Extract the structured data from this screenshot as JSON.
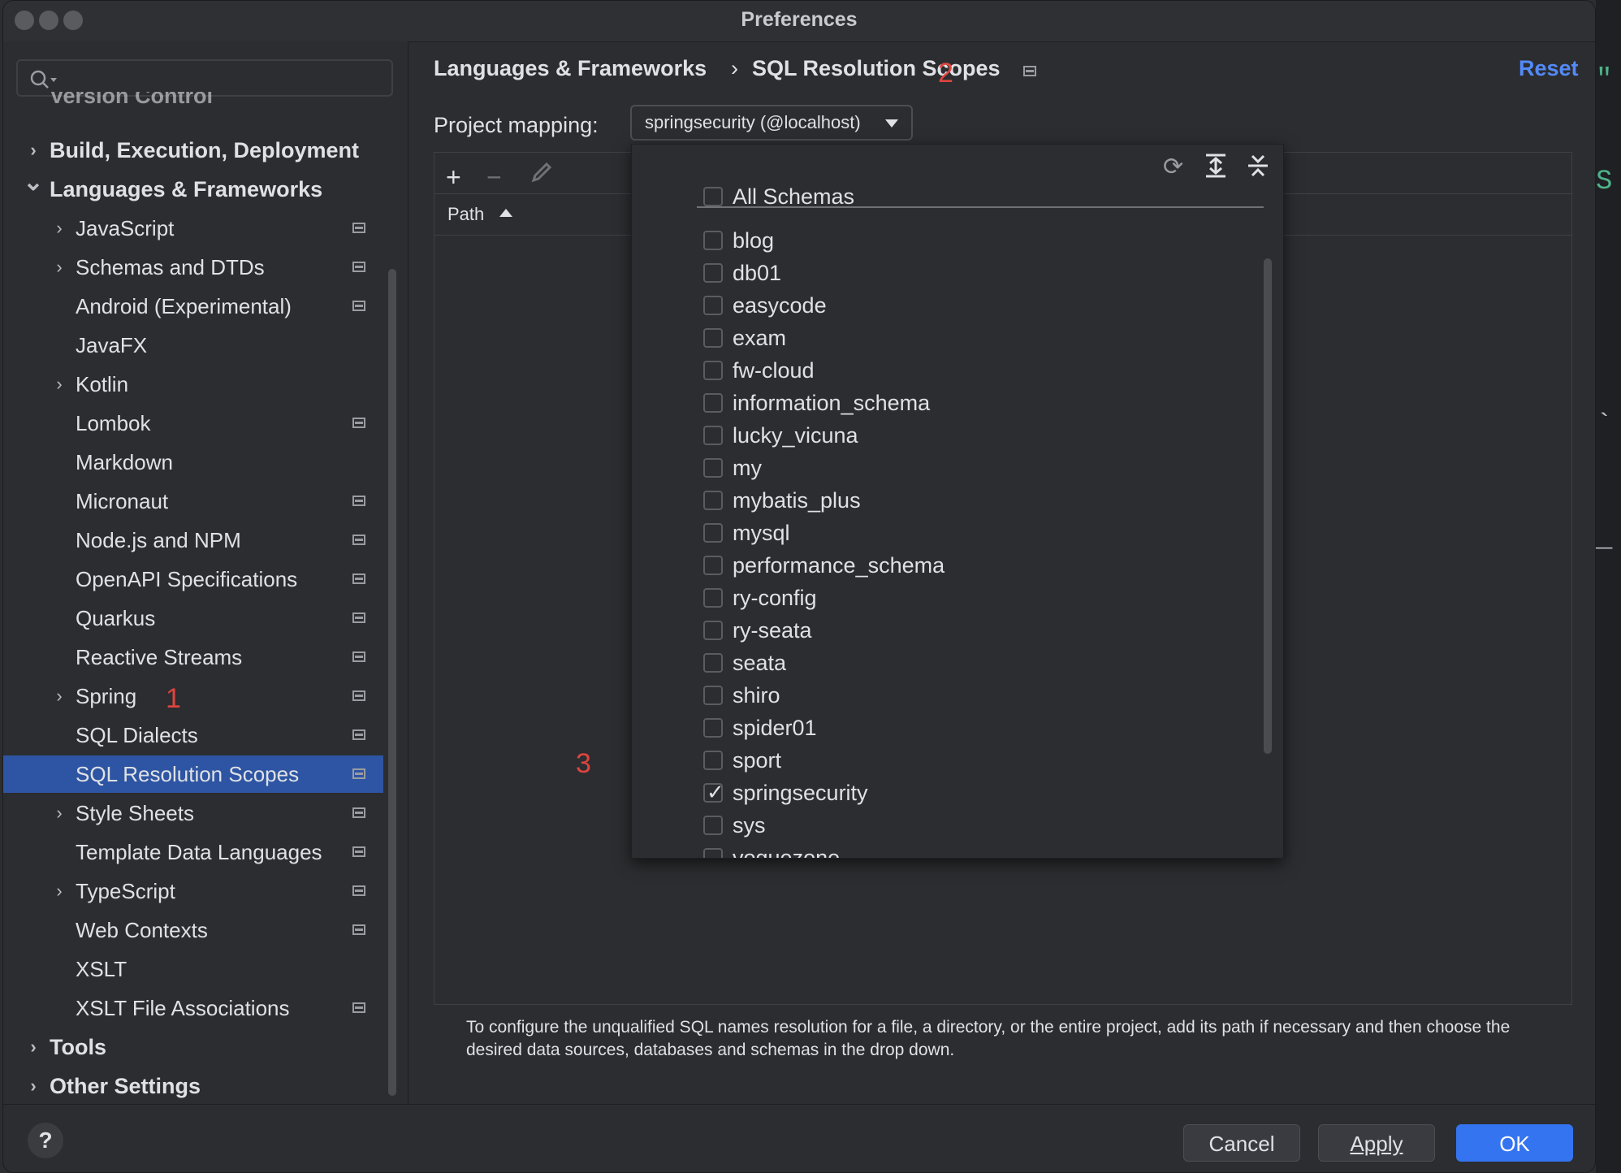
{
  "window": {
    "title": "Preferences"
  },
  "sidebar": {
    "search_placeholder": "",
    "items": [
      {
        "label": "Version Control",
        "level": 0,
        "expand": "none",
        "badge": true
      },
      {
        "label": "Build, Execution, Deployment",
        "level": 0,
        "expand": "collapsed",
        "badge": false
      },
      {
        "label": "Languages & Frameworks",
        "level": 0,
        "expand": "expanded",
        "badge": false
      },
      {
        "label": "JavaScript",
        "level": 1,
        "expand": "collapsed",
        "badge": true
      },
      {
        "label": "Schemas and DTDs",
        "level": 1,
        "expand": "collapsed",
        "badge": true
      },
      {
        "label": "Android (Experimental)",
        "level": 1,
        "expand": "none",
        "badge": true
      },
      {
        "label": "JavaFX",
        "level": 1,
        "expand": "none",
        "badge": false
      },
      {
        "label": "Kotlin",
        "level": 1,
        "expand": "collapsed",
        "badge": false
      },
      {
        "label": "Lombok",
        "level": 1,
        "expand": "none",
        "badge": true
      },
      {
        "label": "Markdown",
        "level": 1,
        "expand": "none",
        "badge": false
      },
      {
        "label": "Micronaut",
        "level": 1,
        "expand": "none",
        "badge": true
      },
      {
        "label": "Node.js and NPM",
        "level": 1,
        "expand": "none",
        "badge": true
      },
      {
        "label": "OpenAPI Specifications",
        "level": 1,
        "expand": "none",
        "badge": true
      },
      {
        "label": "Quarkus",
        "level": 1,
        "expand": "none",
        "badge": true
      },
      {
        "label": "Reactive Streams",
        "level": 1,
        "expand": "none",
        "badge": true
      },
      {
        "label": "Spring",
        "level": 1,
        "expand": "collapsed",
        "badge": true
      },
      {
        "label": "SQL Dialects",
        "level": 1,
        "expand": "none",
        "badge": true
      },
      {
        "label": "SQL Resolution Scopes",
        "level": 1,
        "expand": "none",
        "badge": true,
        "selected": true
      },
      {
        "label": "Style Sheets",
        "level": 1,
        "expand": "collapsed",
        "badge": true
      },
      {
        "label": "Template Data Languages",
        "level": 1,
        "expand": "none",
        "badge": true
      },
      {
        "label": "TypeScript",
        "level": 1,
        "expand": "collapsed",
        "badge": true
      },
      {
        "label": "Web Contexts",
        "level": 1,
        "expand": "none",
        "badge": true
      },
      {
        "label": "XSLT",
        "level": 1,
        "expand": "none",
        "badge": false
      },
      {
        "label": "XSLT File Associations",
        "level": 1,
        "expand": "none",
        "badge": true
      },
      {
        "label": "Tools",
        "level": 0,
        "expand": "collapsed",
        "badge": false
      },
      {
        "label": "Other Settings",
        "level": 0,
        "expand": "collapsed",
        "badge": false
      }
    ]
  },
  "breadcrumb": {
    "parent": "Languages & Frameworks",
    "separator": "›",
    "current": "SQL Resolution Scopes"
  },
  "reset_label": "Reset",
  "project_mapping": {
    "label": "Project mapping:",
    "value": "springsecurity (@localhost)"
  },
  "table": {
    "column": "Path"
  },
  "schemas": {
    "header": "All Schemas",
    "items": [
      {
        "name": "blog",
        "checked": false
      },
      {
        "name": "db01",
        "checked": false
      },
      {
        "name": "easycode",
        "checked": false
      },
      {
        "name": "exam",
        "checked": false
      },
      {
        "name": "fw-cloud",
        "checked": false
      },
      {
        "name": "information_schema",
        "checked": false
      },
      {
        "name": "lucky_vicuna",
        "checked": false
      },
      {
        "name": "my",
        "checked": false
      },
      {
        "name": "mybatis_plus",
        "checked": false
      },
      {
        "name": "mysql",
        "checked": false
      },
      {
        "name": "performance_schema",
        "checked": false
      },
      {
        "name": "ry-config",
        "checked": false
      },
      {
        "name": "ry-seata",
        "checked": false
      },
      {
        "name": "seata",
        "checked": false
      },
      {
        "name": "shiro",
        "checked": false
      },
      {
        "name": "spider01",
        "checked": false
      },
      {
        "name": "sport",
        "checked": false
      },
      {
        "name": "springsecurity",
        "checked": true
      },
      {
        "name": "sys",
        "checked": false
      },
      {
        "name": "voguezone",
        "checked": false
      }
    ]
  },
  "hint": "To configure the unqualified SQL names resolution for a file, a directory, or the entire project, add its path if necessary and then choose the desired data sources, databases and schemas in the drop down.",
  "annotations": {
    "a1": "1",
    "a2": "2",
    "a3": "3"
  },
  "footer": {
    "help": "?",
    "cancel": "Cancel",
    "apply": "Apply",
    "ok": "OK"
  },
  "colors": {
    "accent": "#3574f0",
    "selected": "#2e55a3",
    "link": "#548af7",
    "annotation": "#e0443e"
  }
}
